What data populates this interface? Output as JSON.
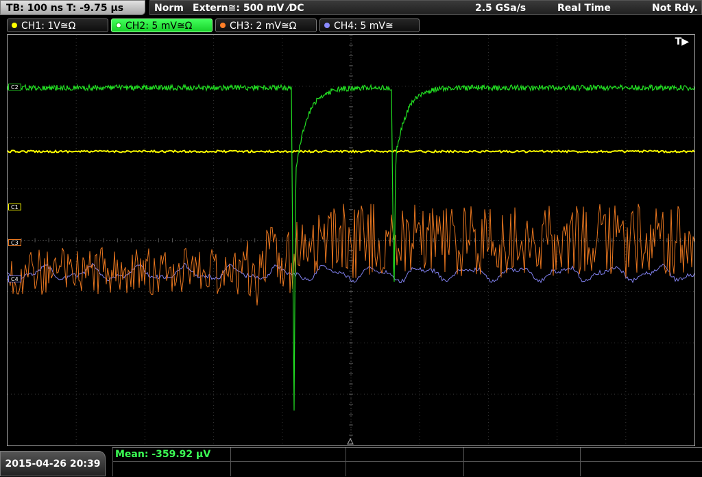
{
  "topbar": {
    "timebase": "TB: 100 ns   T: -9.75 µs",
    "mode": "Norm",
    "trigger": "Extern≅: 500 mV ⁄DC",
    "sample_rate": "2.5 GSa/s",
    "acq_mode": "Real Time",
    "status": "Not Rdy."
  },
  "channels": [
    {
      "label": "CH1: 1V≅Ω",
      "color": "#ffff00",
      "active": false
    },
    {
      "label": "CH2: 5 mV≅Ω",
      "color": "#00ff00",
      "active": true
    },
    {
      "label": "CH3: 2 mV≅Ω",
      "color": "#ff7f27",
      "active": false
    },
    {
      "label": "CH4: 5 mV≅",
      "color": "#8a8aff",
      "active": false
    }
  ],
  "markers": {
    "c1": "C1",
    "c2": "C2",
    "c3": "C3",
    "c4": "C4"
  },
  "trigger_marker": "T▶",
  "datetime": "2015-04-26 20:39",
  "measurement": {
    "mean": "Mean: -359.92 µV"
  },
  "colors": {
    "ch1": "#ffff00",
    "ch2": "#22dd22",
    "ch3": "#e8761f",
    "ch4": "#8080ee",
    "grid": "#3a3a3a"
  }
}
